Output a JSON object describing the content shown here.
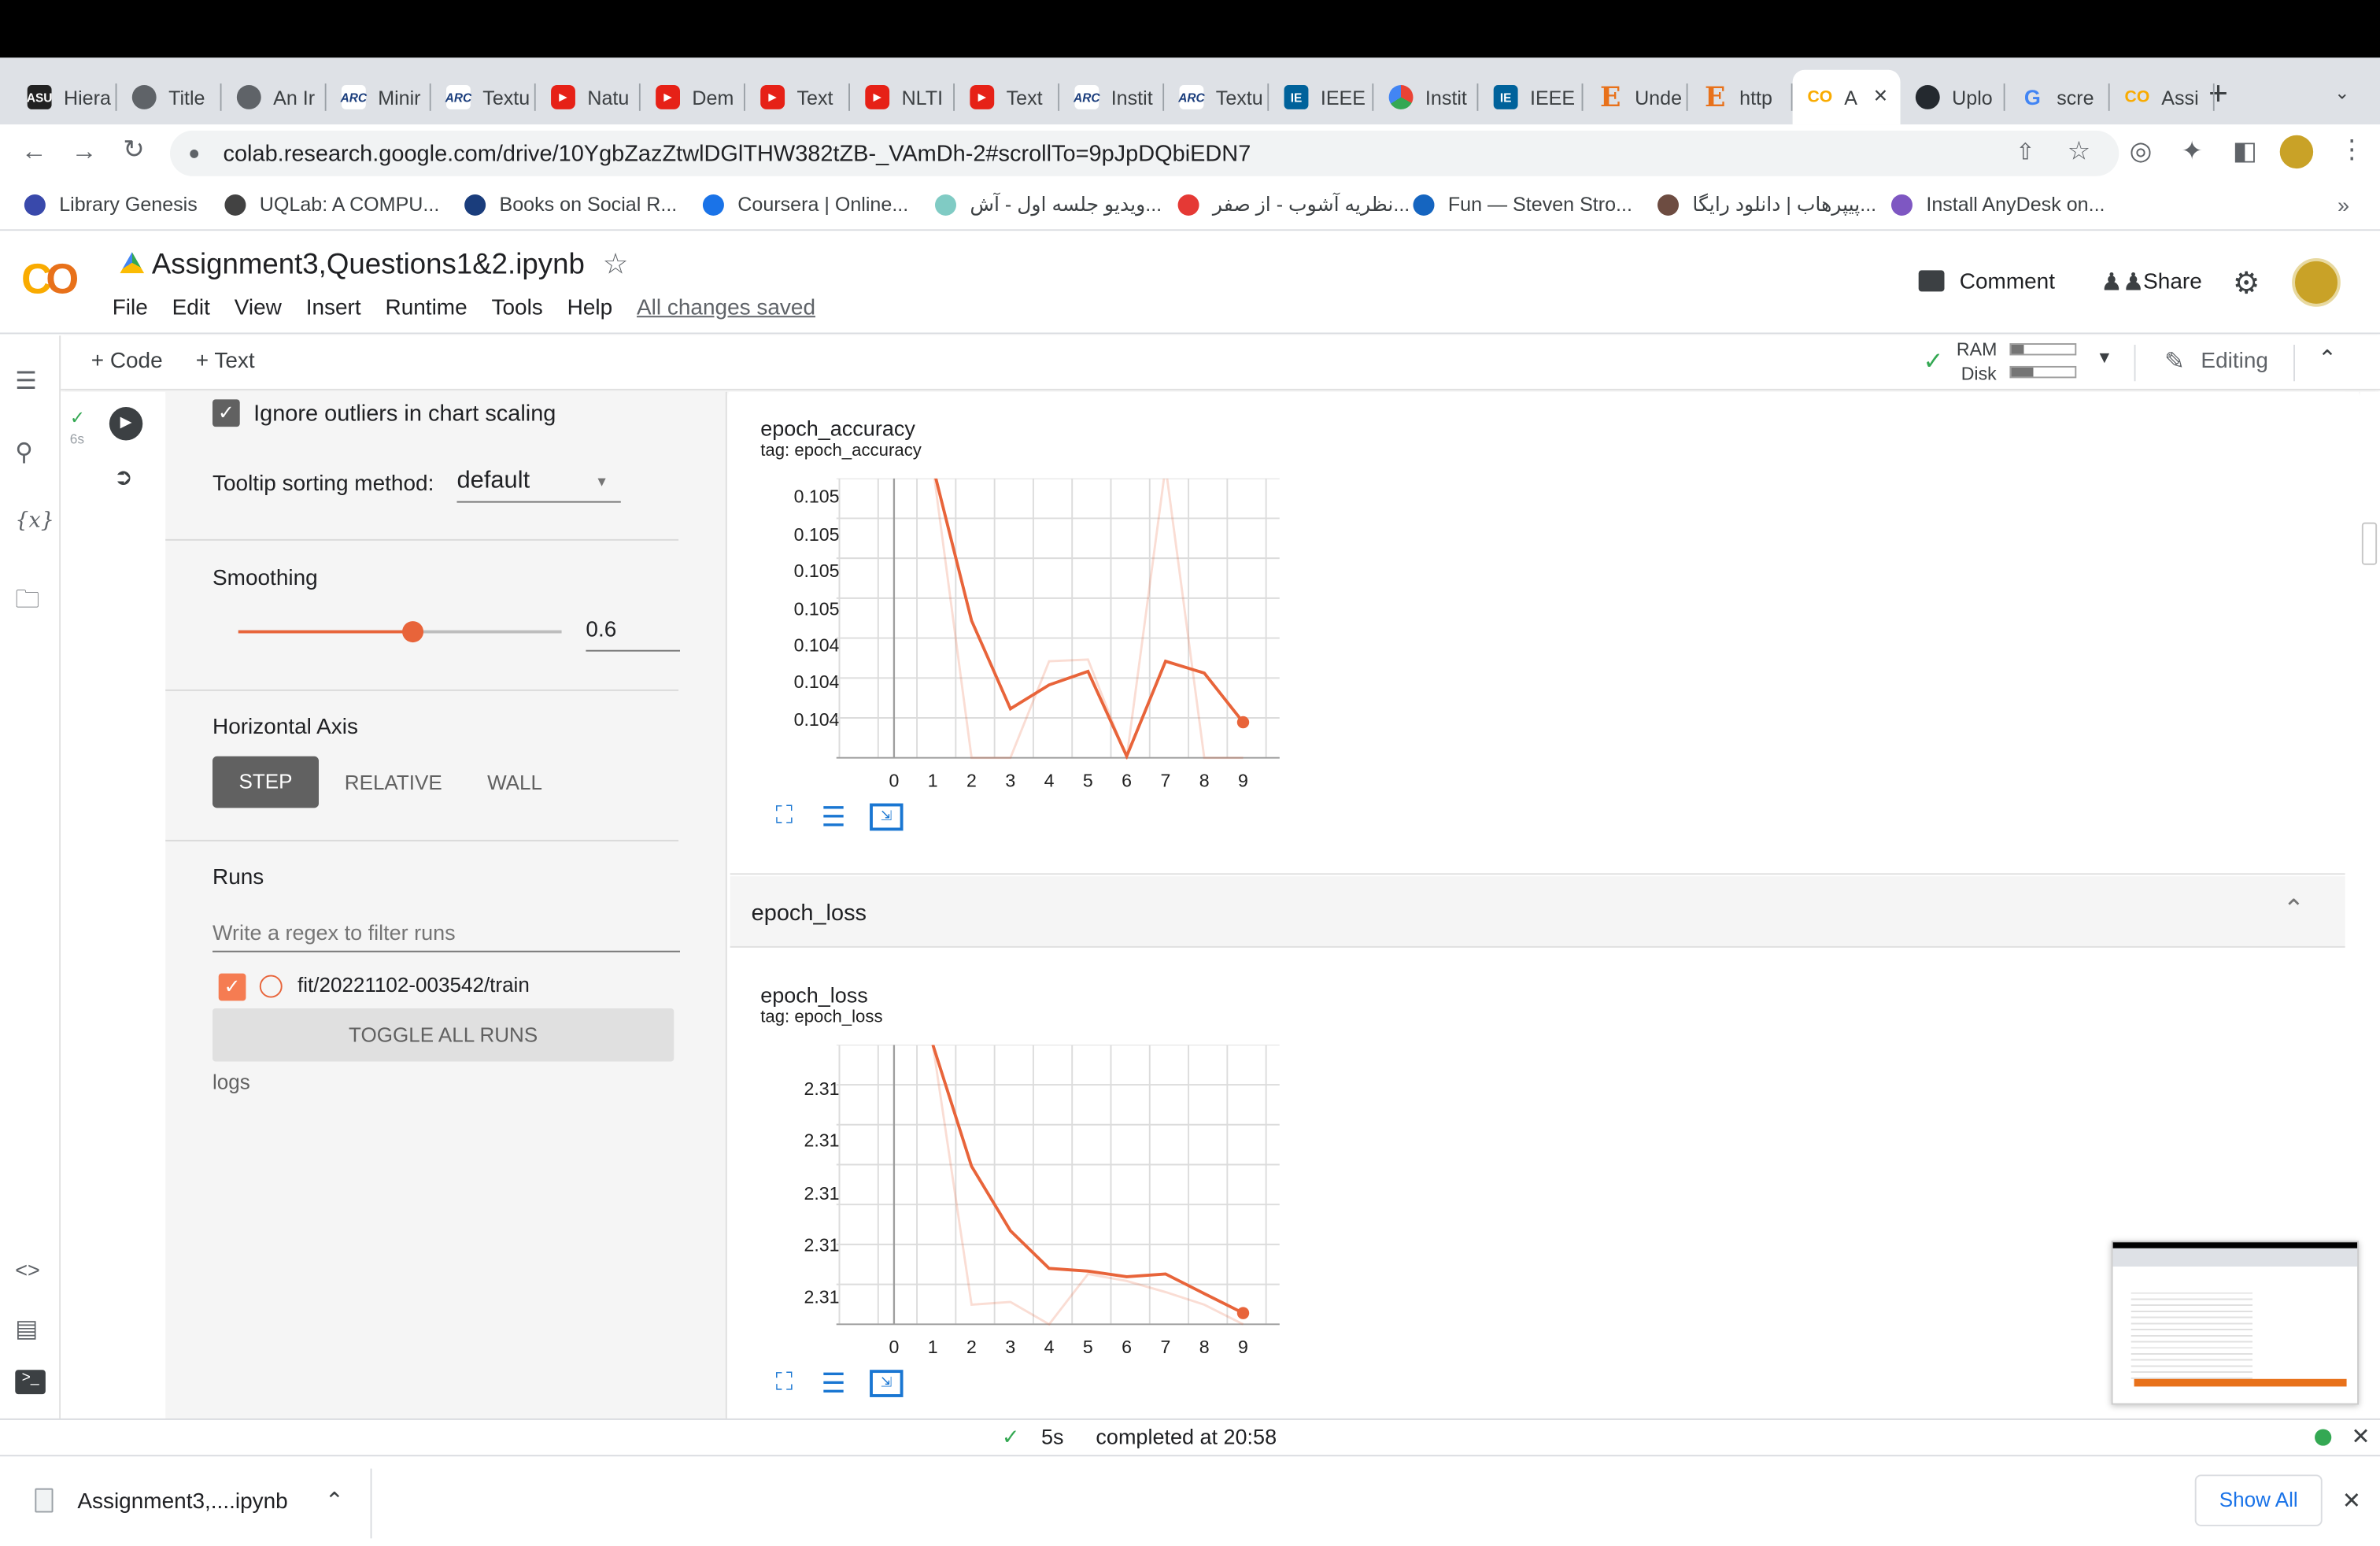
{
  "browser": {
    "tabs": [
      {
        "label": "Hiera",
        "icon": "asu"
      },
      {
        "label": "Title",
        "icon": "globe"
      },
      {
        "label": "An Ir",
        "icon": "globe"
      },
      {
        "label": "Minir",
        "icon": "arc"
      },
      {
        "label": "Textu",
        "icon": "arc"
      },
      {
        "label": "Natu",
        "icon": "yt"
      },
      {
        "label": "Dem",
        "icon": "yt"
      },
      {
        "label": "Text",
        "icon": "yt"
      },
      {
        "label": "NLTI",
        "icon": "yt"
      },
      {
        "label": "Text",
        "icon": "yt"
      },
      {
        "label": "Instit",
        "icon": "arc"
      },
      {
        "label": "Textu",
        "icon": "arc"
      },
      {
        "label": "IEEE",
        "icon": "ieee"
      },
      {
        "label": "Instit",
        "icon": "multi"
      },
      {
        "label": "IEEE",
        "icon": "ieee"
      },
      {
        "label": "Unde",
        "icon": "e"
      },
      {
        "label": "http",
        "icon": "e"
      },
      {
        "label": "A",
        "icon": "co",
        "active": true
      },
      {
        "label": "Uplo",
        "icon": "gh"
      },
      {
        "label": "scre",
        "icon": "g"
      },
      {
        "label": "Assi",
        "icon": "co"
      }
    ],
    "new_tab": "+",
    "url": "colab.research.google.com/drive/10YgbZazZtwlDGlTHW382tZB-_VAmDh-2#scrollTo=9pJpDQbiEDN7",
    "bookmarks": [
      {
        "label": "Library Genesis",
        "color": "#3949ab"
      },
      {
        "label": "UQLab: A COMPU...",
        "color": "#424242"
      },
      {
        "label": "Books on Social R...",
        "color": "#1a3d7c"
      },
      {
        "label": "Coursera | Online...",
        "color": "#1a73e8"
      },
      {
        "label": "ویدیو جلسه اول - آش...",
        "color": "#80cbc4"
      },
      {
        "label": "نظریه آشوب - از صفر...",
        "color": "#e53935"
      },
      {
        "label": "Fun — Steven Stro...",
        "color": "#1565c0"
      },
      {
        "label": "پیپرهاب | دانلود رایگا...",
        "color": "#6d4c41"
      },
      {
        "label": "Install AnyDesk on...",
        "color": "#7e57c2"
      }
    ],
    "bookmarks_more": "»"
  },
  "colab": {
    "notebook_title": "Assignment3,Questions1&2.ipynb",
    "menu": [
      "File",
      "Edit",
      "View",
      "Insert",
      "Runtime",
      "Tools",
      "Help"
    ],
    "saved_status": "All changes saved",
    "comment": "Comment",
    "share": "Share",
    "add_code": "+ Code",
    "add_text": "+ Text",
    "ram": "RAM",
    "disk": "Disk",
    "editing": "Editing",
    "cell_exec_time": "6s",
    "status_time": "5s",
    "status_text": "completed at 20:58"
  },
  "tensorboard": {
    "ignore_outliers": "Ignore outliers in chart scaling",
    "tooltip_label": "Tooltip sorting method:",
    "tooltip_value": "default",
    "smoothing_label": "Smoothing",
    "smoothing_value": "0.6",
    "smoothing": 0.6,
    "haxis_label": "Horizontal Axis",
    "haxis_options": [
      "STEP",
      "RELATIVE",
      "WALL"
    ],
    "runs_label": "Runs",
    "runs_filter_placeholder": "Write a regex to filter runs",
    "run_name": "fit/20221102-003542/train",
    "toggle_all": "TOGGLE ALL RUNS",
    "logs": "logs",
    "loss_section": "epoch_loss",
    "run_color": "#e8643a"
  },
  "charts": {
    "accuracy": {
      "title": "epoch_accuracy",
      "tag": "tag: epoch_accuracy",
      "yticks": [
        "0.105",
        "0.105",
        "0.105",
        "0.105",
        "0.104",
        "0.104",
        "0.104"
      ],
      "xticks": [
        "0",
        "1",
        "2",
        "3",
        "4",
        "5",
        "6",
        "7",
        "8",
        "9"
      ]
    },
    "loss": {
      "title": "epoch_loss",
      "tag": "tag: epoch_loss",
      "yticks": [
        "2.31",
        "2.31",
        "2.31",
        "2.31",
        "2.31"
      ],
      "xticks": [
        "0",
        "1",
        "2",
        "3",
        "4",
        "5",
        "6",
        "7",
        "8",
        "9"
      ]
    }
  },
  "chart_data": [
    {
      "type": "line",
      "title": "epoch_accuracy",
      "subtitle": "tag: epoch_accuracy",
      "x": [
        0,
        1,
        2,
        3,
        4,
        5,
        6,
        7,
        8,
        9
      ],
      "xlim": [
        0,
        9
      ],
      "ylim": [
        0.10385,
        0.1055
      ],
      "ytick_labels": [
        "0.105",
        "0.105",
        "0.105",
        "0.105",
        "0.104",
        "0.104",
        "0.104"
      ],
      "grid": true,
      "series": [
        {
          "name": "fit/20221102-003542/train",
          "style": "smoothed",
          "values": [
            null,
            0.10557,
            0.10466,
            0.10414,
            0.10428,
            0.10436,
            0.10386,
            0.10442,
            0.10435,
            0.10406
          ]
        },
        {
          "name": "fit/20221102-003542/train",
          "style": "raw",
          "values": [
            null,
            0.10557,
            0.10385,
            0.10385,
            0.10442,
            0.10443,
            0.10385,
            0.10557,
            0.10385,
            0.10385
          ]
        }
      ]
    },
    {
      "type": "line",
      "title": "epoch_loss",
      "subtitle": "tag: epoch_loss",
      "x": [
        0,
        1,
        2,
        3,
        4,
        5,
        6,
        7,
        8,
        9
      ],
      "xlim": [
        0,
        9
      ],
      "ylim": [
        2.3085,
        2.3105
      ],
      "ytick_labels": [
        "2.31",
        "2.31",
        "2.31",
        "2.31",
        "2.31"
      ],
      "grid": true,
      "series": [
        {
          "name": "fit/20221102-003542/train",
          "style": "smoothed",
          "values": [
            null,
            2.3105,
            2.30963,
            2.30917,
            2.3089,
            2.30888,
            2.30884,
            2.30886,
            2.30872,
            2.30858
          ]
        },
        {
          "name": "fit/20221102-003542/train",
          "style": "raw",
          "values": [
            null,
            2.3105,
            2.30864,
            2.30866,
            2.3085,
            2.30886,
            2.30881,
            2.30873,
            2.30864,
            2.3085
          ]
        }
      ]
    }
  ],
  "downloads": {
    "file_name": "Assignment3,....ipynb",
    "show_all": "Show All"
  }
}
